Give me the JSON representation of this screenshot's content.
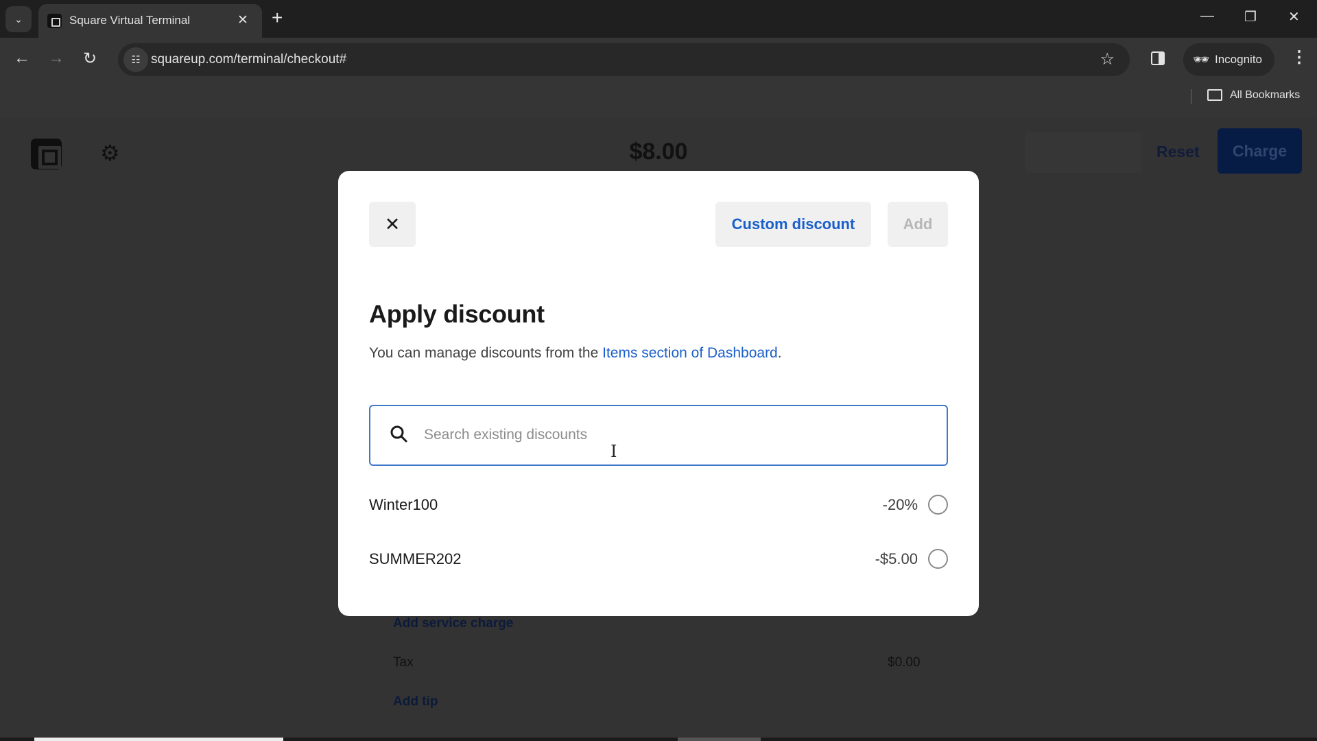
{
  "browser": {
    "tab_title": "Square Virtual Terminal",
    "url": "squareup.com/terminal/checkout#",
    "incognito_label": "Incognito",
    "bookmarks_label": "All Bookmarks",
    "icons": {
      "tab_search": "chevron-down-icon",
      "close_tab": "close-icon",
      "new_tab": "plus-icon",
      "back": "arrow-left-icon",
      "forward": "arrow-right-icon",
      "reload": "reload-icon",
      "site_info": "tune-icon",
      "bookmark": "star-icon",
      "side_panel": "side-panel-icon",
      "incognito": "incognito-icon",
      "menu": "kebab-menu-icon",
      "folder": "folder-icon",
      "minimize": "minimize-icon",
      "restore": "restore-icon",
      "close_window": "close-icon"
    }
  },
  "app": {
    "total": "$8.00",
    "reset_label": "Reset",
    "charge_label": "Charge",
    "faint_button_label": "",
    "background_rows": {
      "service_charge_link": "Add service charge",
      "tax_label": "Tax",
      "tax_value": "$0.00",
      "add_tip_link": "Add tip"
    }
  },
  "modal": {
    "close_label": "×",
    "custom_discount_label": "Custom discount",
    "add_label": "Add",
    "title": "Apply discount",
    "description_prefix": "You can manage discounts from the ",
    "description_link": "Items section of Dashboard",
    "description_suffix": ".",
    "search": {
      "placeholder": "Search existing discounts",
      "value": ""
    },
    "discounts": [
      {
        "name": "Winter100",
        "value": "-20%",
        "selected": false
      },
      {
        "name": "SUMMER202",
        "value": "-$5.00",
        "selected": false
      }
    ]
  },
  "colors": {
    "accent": "#1a5fc9",
    "charge_button_dimmed": "#061c45",
    "overlay_background": "#333333"
  }
}
